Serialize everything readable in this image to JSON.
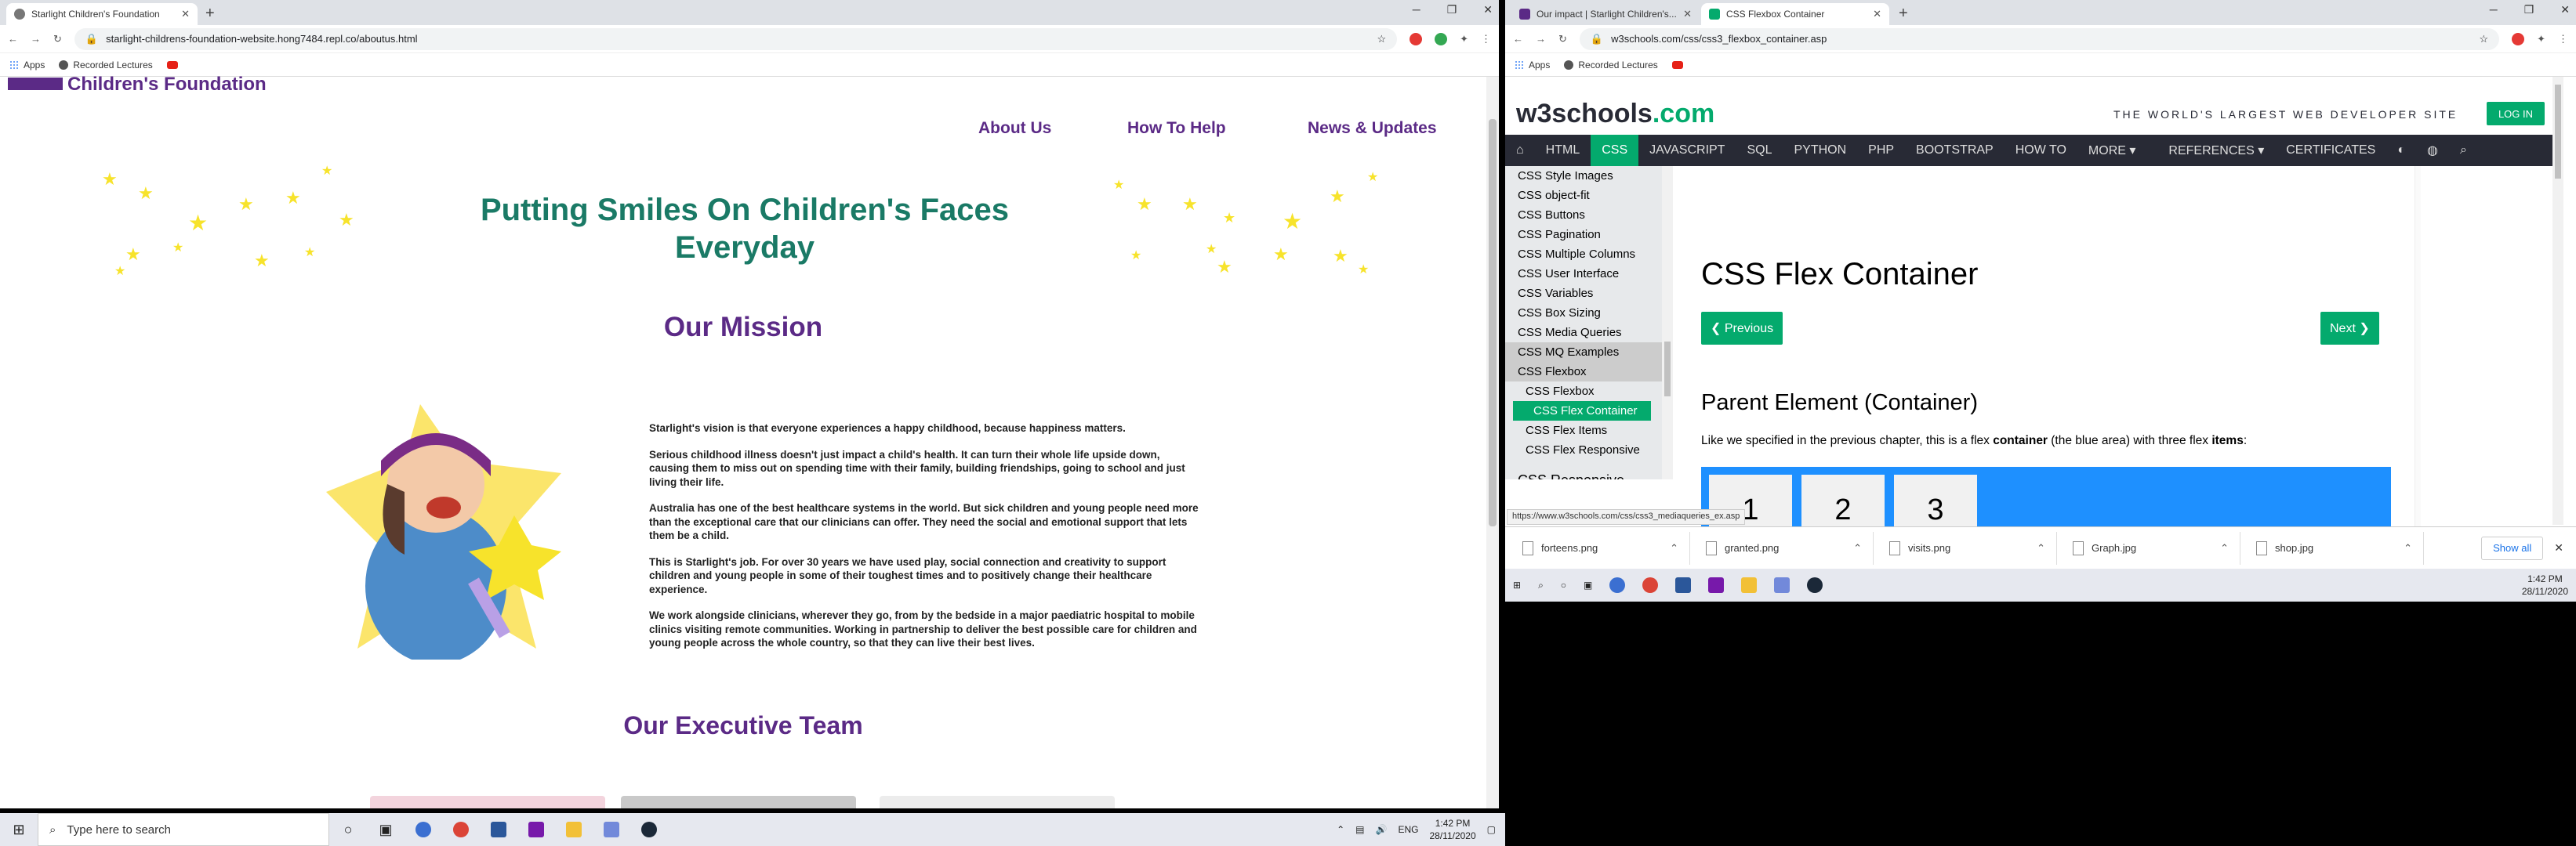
{
  "left": {
    "tab_title": "Starlight Children's Foundation",
    "url": "starlight-childrens-foundation-website.hong7484.repl.co/aboutus.html",
    "bookmarks": [
      "Apps",
      "Recorded Lectures"
    ],
    "logo": "Children's Foundation",
    "nav": [
      "About Us",
      "How To Help",
      "News & Updates"
    ],
    "hero": "Putting Smiles On Children's Faces Everyday",
    "mission_heading": "Our Mission",
    "paragraphs": [
      "Starlight's vision is that everyone experiences a happy childhood, because happiness matters.",
      "Serious childhood illness doesn't just impact a child's health. It can turn their whole life upside down, causing them to miss out on spending time with their family, building friendships, going to school and just living their life.",
      "Australia has one of the best healthcare systems in the world. But sick children and young people need more than the exceptional care that our clinicians can offer. They need the social and emotional support that lets them be a child.",
      "This is Starlight's job. For over 30 years we have used play, social connection and creativity to support children and young people in some of their toughest times and to positively change their healthcare experience.",
      "We work alongside clinicians, wherever they go, from by the bedside in a major paediatric hospital to mobile clinics visiting remote communities. Working in partnership to deliver the best possible care for children and young people across the whole country, so that they can live their best lives."
    ],
    "team_heading": "Our Executive Team"
  },
  "right": {
    "tabs": [
      "Our impact | Starlight Children's...",
      "CSS Flexbox Container"
    ],
    "url": "w3schools.com/css/css3_flexbox_container.asp",
    "bookmarks": [
      "Apps",
      "Recorded Lectures"
    ],
    "logo_main": "w3schools",
    "logo_suffix": ".com",
    "tagline": "THE WORLD'S LARGEST WEB DEVELOPER SITE",
    "login": "LOG IN",
    "topnav": [
      "HTML",
      "CSS",
      "JAVASCRIPT",
      "SQL",
      "PYTHON",
      "PHP",
      "BOOTSTRAP",
      "HOW TO",
      "MORE ▾",
      "REFERENCES ▾",
      "CERTIFICATES"
    ],
    "sidebar": [
      "CSS Style Images",
      "CSS object-fit",
      "CSS Buttons",
      "CSS Pagination",
      "CSS Multiple Columns",
      "CSS User Interface",
      "CSS Variables",
      "CSS Box Sizing",
      "CSS Media Queries",
      "CSS MQ Examples",
      "CSS Flexbox"
    ],
    "sidebar_sub": [
      "CSS Flexbox",
      "CSS Flex Container",
      "CSS Flex Items",
      "CSS Flex Responsive"
    ],
    "sidebar_next": "CSS Responsive",
    "title": "CSS Flex Container",
    "prev": "❮ Previous",
    "next": "Next ❯",
    "subtitle": "Parent Element (Container)",
    "desc_a": "Like we specified in the previous chapter, this is a flex ",
    "desc_b": "container",
    "desc_c": " (the blue area) with three flex ",
    "desc_d": "items",
    "desc_e": ":",
    "flex_items": [
      "1",
      "2",
      "3"
    ],
    "status_url": "https://www.w3schools.com/css/css3_mediaqueries_ex.asp",
    "downloads": [
      "forteens.png",
      "granted.png",
      "visits.png",
      "Graph.jpg",
      "shop.jpg"
    ],
    "show_all": "Show all",
    "time": "1:42 PM",
    "date": "28/11/2020"
  },
  "taskbar": {
    "search_placeholder": "Type here to search",
    "lang": "ENG",
    "time": "1:42 PM",
    "date": "28/11/2020"
  },
  "colors": {
    "green": "#04aa6d",
    "purple": "#5b2a86",
    "teal": "#1a7a66",
    "star": "#f7e32b"
  }
}
